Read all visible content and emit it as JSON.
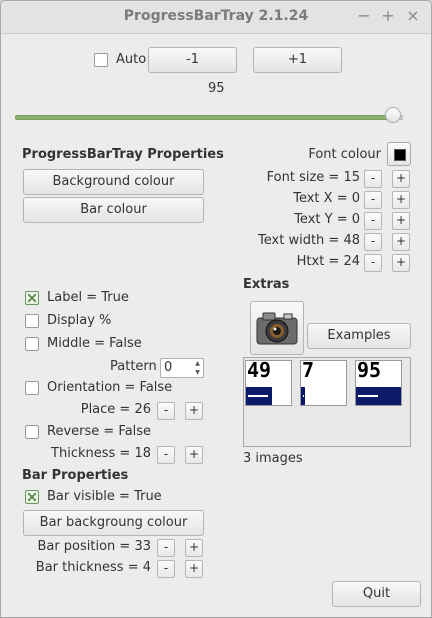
{
  "window": {
    "title": "ProgressBarTray 2.1.24",
    "minimize": "−",
    "maximize": "+",
    "close": "×"
  },
  "top": {
    "auto_label": "Auto",
    "minus_label": "-1",
    "plus_label": "+1",
    "value": "95"
  },
  "slider": {
    "value": 95,
    "min": 0,
    "max": 100
  },
  "props": {
    "heading": "ProgressBarTray Properties",
    "bg_colour_btn": "Background colour",
    "bar_colour_btn": "Bar colour",
    "font_colour_label": "Font colour",
    "font_size": "Font size = 15",
    "text_x": "Text X = 0",
    "text_y": "Text Y = 0",
    "text_width": "Text width = 48",
    "htxt": "Htxt = 24",
    "minus": "-",
    "plus": "+"
  },
  "options": {
    "label": "Label = True",
    "display_pct": "Display %",
    "middle": "Middle = False",
    "pattern_label": "Pattern",
    "pattern_value": "0",
    "orientation": "Orientation = False",
    "place": "Place = 26",
    "reverse": "Reverse = False",
    "thickness": "Thickness = 18"
  },
  "bar_props": {
    "heading": "Bar Properties",
    "visible": "Bar visible = True",
    "bg_colour_btn": "Bar backgroung colour",
    "position": "Bar position =  33",
    "thickness": "Bar thickness = 4"
  },
  "extras": {
    "heading": "Extras",
    "examples_btn": "Examples",
    "thumbs": [
      "49",
      "7",
      "95"
    ],
    "count": "3 images"
  },
  "quit_label": "Quit",
  "colors": {
    "bar": "#0b1a6b",
    "slider": "#8fb36f",
    "font_colour": "#000000"
  }
}
